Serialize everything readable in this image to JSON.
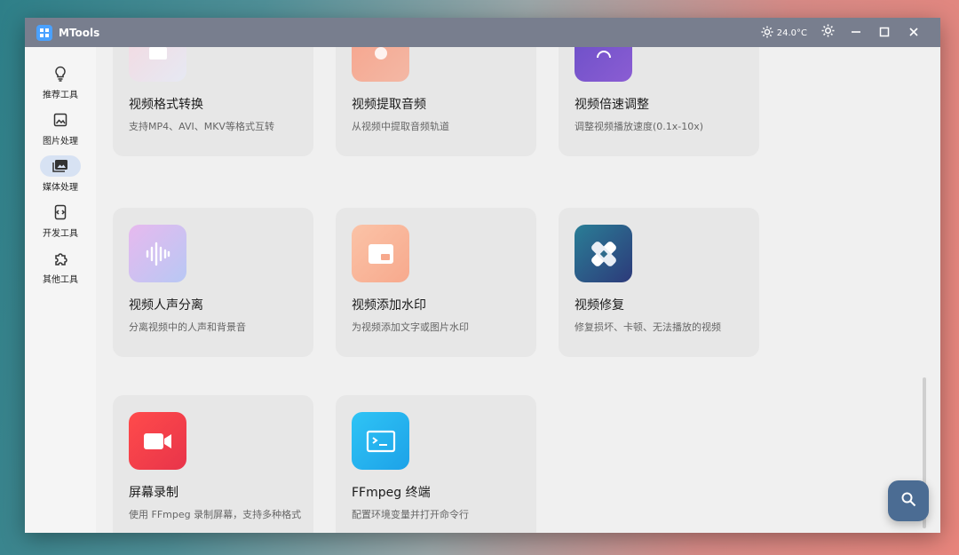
{
  "window": {
    "title": "MTools",
    "weather": "24.0°C",
    "controls": {
      "theme": "sun-icon",
      "minimize": "minimize-icon",
      "maximize": "maximize-icon",
      "close": "close-icon"
    }
  },
  "sidebar": {
    "items": [
      {
        "label": "推荐工具",
        "icon": "lightbulb-icon",
        "active": false
      },
      {
        "label": "图片处理",
        "icon": "image-icon",
        "active": false
      },
      {
        "label": "媒体处理",
        "icon": "media-icon",
        "active": true
      },
      {
        "label": "开发工具",
        "icon": "code-icon",
        "active": false
      },
      {
        "label": "其他工具",
        "icon": "puzzle-icon",
        "active": false
      }
    ],
    "settings_icon": "gear-icon"
  },
  "cards": [
    {
      "title": "视频格式转换",
      "desc": "支持MP4、AVI、MKV等格式互转"
    },
    {
      "title": "视频提取音频",
      "desc": "从视频中提取音频轨道"
    },
    {
      "title": "视频倍速调整",
      "desc": "调整视频播放速度(0.1x-10x)"
    },
    {
      "title": "视频人声分离",
      "desc": "分离视频中的人声和背景音"
    },
    {
      "title": "视频添加水印",
      "desc": "为视频添加文字或图片水印"
    },
    {
      "title": "视频修复",
      "desc": "修复损坏、卡顿、无法播放的视频"
    },
    {
      "title": "屏幕录制",
      "desc": "使用 FFmpeg 录制屏幕，支持多种格式"
    },
    {
      "title": "FFmpeg 终端",
      "desc": "配置环境变量并打开命令行"
    }
  ],
  "fab": {
    "icon": "search-icon"
  },
  "colors": {
    "titlebar": "#787e8e",
    "accent": "#4aa1ff",
    "fab": "#4b6c93"
  }
}
